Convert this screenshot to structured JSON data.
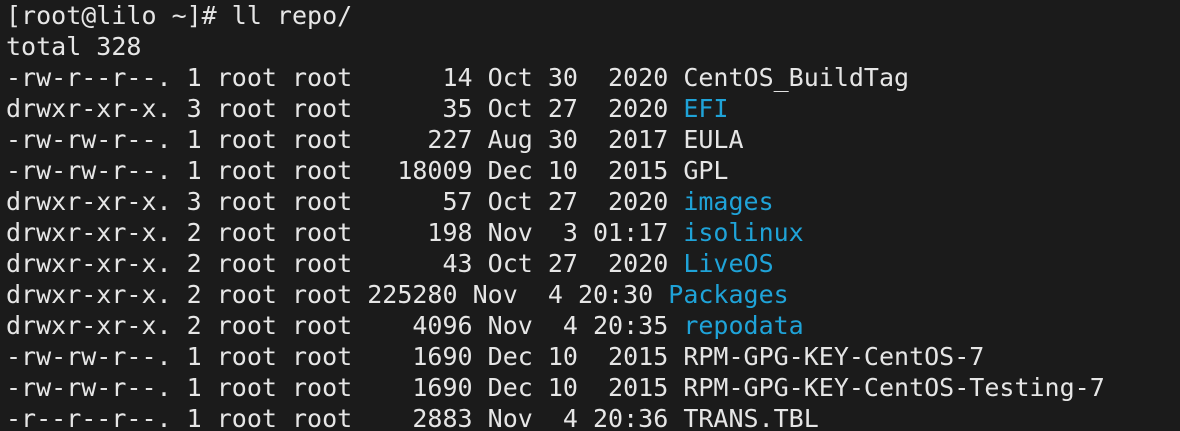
{
  "terminal": {
    "prompt": "[root@lilo ~]# ll repo/",
    "total": "total 328",
    "colors": {
      "background": "#1b1b1b",
      "text": "#e6e6e6",
      "directory": "#1fa3d8"
    },
    "entries": [
      {
        "meta": "-rw-r--r--. 1 root root      14 Oct 30  2020 ",
        "name": "CentOS_BuildTag",
        "type": "file"
      },
      {
        "meta": "drwxr-xr-x. 3 root root      35 Oct 27  2020 ",
        "name": "EFI",
        "type": "dir"
      },
      {
        "meta": "-rw-rw-r--. 1 root root     227 Aug 30  2017 ",
        "name": "EULA",
        "type": "file"
      },
      {
        "meta": "-rw-rw-r--. 1 root root   18009 Dec 10  2015 ",
        "name": "GPL",
        "type": "file"
      },
      {
        "meta": "drwxr-xr-x. 3 root root      57 Oct 27  2020 ",
        "name": "images",
        "type": "dir"
      },
      {
        "meta": "drwxr-xr-x. 2 root root     198 Nov  3 01:17 ",
        "name": "isolinux",
        "type": "dir"
      },
      {
        "meta": "drwxr-xr-x. 2 root root      43 Oct 27  2020 ",
        "name": "LiveOS",
        "type": "dir"
      },
      {
        "meta": "drwxr-xr-x. 2 root root 225280 Nov  4 20:30 ",
        "name": "Packages",
        "type": "dir"
      },
      {
        "meta": "drwxr-xr-x. 2 root root    4096 Nov  4 20:35 ",
        "name": "repodata",
        "type": "dir"
      },
      {
        "meta": "-rw-rw-r--. 1 root root    1690 Dec 10  2015 ",
        "name": "RPM-GPG-KEY-CentOS-7",
        "type": "file"
      },
      {
        "meta": "-rw-rw-r--. 1 root root    1690 Dec 10  2015 ",
        "name": "RPM-GPG-KEY-CentOS-Testing-7",
        "type": "file"
      },
      {
        "meta": "-r--r--r--. 1 root root    2883 Nov  4 20:36 ",
        "name": "TRANS.TBL",
        "type": "file"
      }
    ]
  }
}
